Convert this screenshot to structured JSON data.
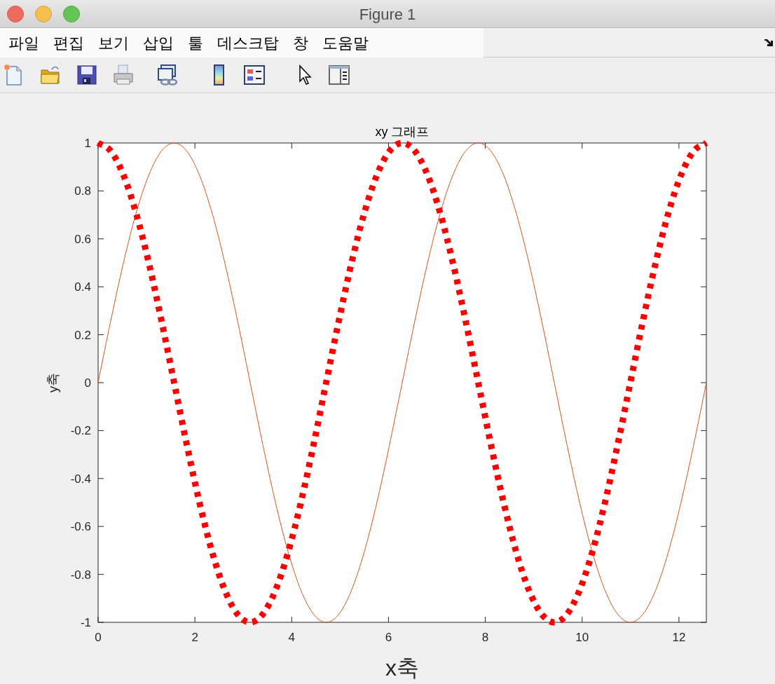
{
  "window": {
    "title": "Figure 1"
  },
  "menu": [
    "파일",
    "편집",
    "보기",
    "삽입",
    "툴",
    "데스크탑",
    "창",
    "도움말"
  ],
  "toolbar": [
    {
      "kind": "new"
    },
    {
      "kind": "open"
    },
    {
      "kind": "save"
    },
    {
      "kind": "print"
    },
    {
      "kind": "link"
    },
    {
      "kind": "colorbar"
    },
    {
      "kind": "legend"
    },
    {
      "kind": "pointer"
    },
    {
      "kind": "panel"
    }
  ],
  "figure": {
    "chart_data": {
      "type": "line",
      "title": "xy 그래프",
      "xlabel": "x축",
      "ylabel": "y축",
      "x": [
        0,
        0.262,
        0.524,
        0.785,
        1.047,
        1.309,
        1.571,
        1.833,
        2.094,
        2.356,
        2.618,
        2.88,
        3.142,
        3.403,
        3.665,
        3.927,
        4.189,
        4.451,
        4.712,
        4.974,
        5.236,
        5.498,
        5.76,
        6.021,
        6.283,
        6.545,
        6.807,
        7.069,
        7.33,
        7.592,
        7.854,
        8.116,
        8.378,
        8.639,
        8.901,
        9.163,
        9.425,
        9.687,
        9.948,
        10.21,
        10.472,
        10.734,
        10.996,
        11.257,
        11.519,
        11.781,
        12.043,
        12.305,
        12.566
      ],
      "series": [
        {
          "color": "#d95319",
          "line_style": "solid",
          "values": [
            0,
            0.259,
            0.5,
            0.707,
            0.866,
            0.966,
            1,
            0.966,
            0.866,
            0.707,
            0.5,
            0.259,
            0,
            -0.259,
            -0.5,
            -0.707,
            -0.866,
            -0.966,
            -1,
            -0.966,
            -0.866,
            -0.707,
            -0.5,
            -0.259,
            0,
            0.259,
            0.5,
            0.707,
            0.866,
            0.966,
            1,
            0.966,
            0.866,
            0.707,
            0.5,
            0.259,
            0,
            -0.259,
            -0.5,
            -0.707,
            -0.866,
            -0.966,
            -1,
            -0.966,
            -0.866,
            -0.707,
            -0.5,
            -0.259,
            0
          ]
        },
        {
          "color": "#ff0000",
          "line_style": "dotted",
          "values": [
            1,
            0.966,
            0.866,
            0.707,
            0.5,
            0.259,
            0,
            -0.259,
            -0.5,
            -0.707,
            -0.866,
            -0.966,
            -1,
            -0.966,
            -0.866,
            -0.707,
            -0.5,
            -0.259,
            0,
            0.259,
            0.5,
            0.707,
            0.866,
            0.966,
            1,
            0.966,
            0.866,
            0.707,
            0.5,
            0.259,
            0,
            -0.259,
            -0.5,
            -0.707,
            -0.866,
            -0.966,
            -1,
            -0.966,
            -0.866,
            -0.707,
            -0.5,
            -0.259,
            0,
            0.259,
            0.5,
            0.707,
            0.866,
            0.966,
            1
          ]
        }
      ],
      "xlim": [
        0,
        12.566
      ],
      "ylim": [
        -1,
        1
      ],
      "xticks": [
        0,
        2,
        4,
        6,
        8,
        10,
        12
      ],
      "yticks": [
        -1,
        -0.8,
        -0.6,
        -0.4,
        -0.2,
        0,
        0.2,
        0.4,
        0.6,
        0.8,
        1
      ]
    }
  }
}
